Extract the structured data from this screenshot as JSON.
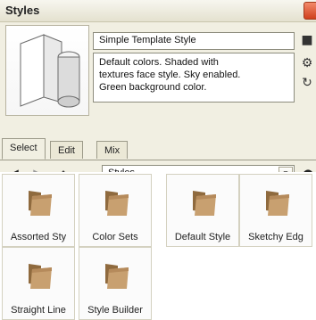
{
  "window": {
    "title": "Styles"
  },
  "style_info": {
    "name": "Simple Template Style",
    "description_lines": [
      "Default colors.  Shaded with",
      "textures face style.  Sky enabled.",
      "Green background color."
    ]
  },
  "tabs": [
    {
      "label": "Select"
    },
    {
      "label": "Edit"
    },
    {
      "label": "Mix"
    }
  ],
  "toolbar": {
    "collection": "Styles"
  },
  "colors": {
    "folder_body": "#c8a070",
    "folder_front": "#b58a5b",
    "folder_shadow": "#8f6a3e"
  },
  "collections": [
    {
      "label": "Assorted Sty"
    },
    {
      "label": "Color Sets"
    },
    {
      "label": "Default Style"
    },
    {
      "label": "Sketchy Edg"
    },
    {
      "label": "Straight Line"
    },
    {
      "label": "Style Builder"
    }
  ]
}
